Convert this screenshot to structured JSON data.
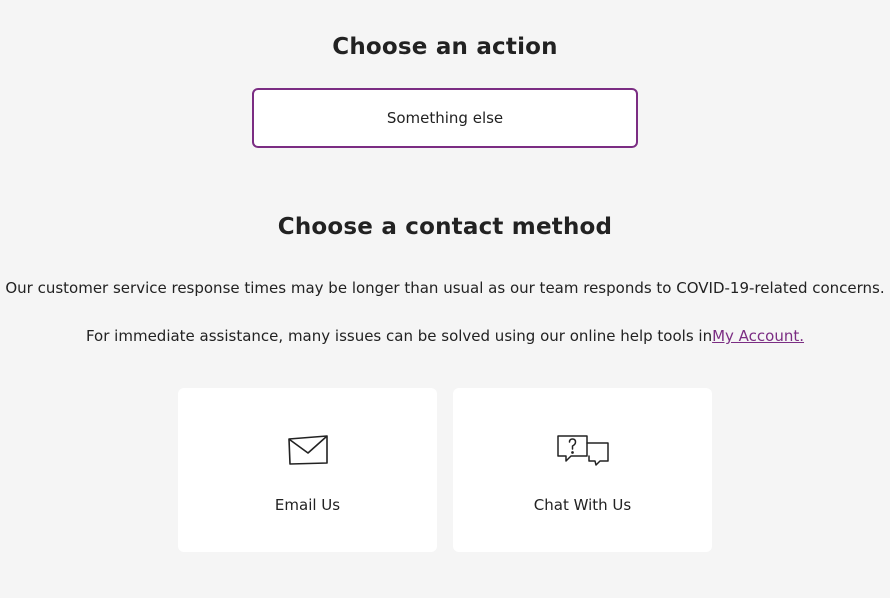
{
  "action_section": {
    "heading": "Choose an action",
    "selected_option": "Something else"
  },
  "contact_section": {
    "heading": "Choose a contact method",
    "notice_line1": "Our customer service response times may be longer than usual as our team responds to COVID-19-related concerns.",
    "notice_line2_prefix": "For immediate assistance, many issues can be solved using our online help tools in",
    "notice_line2_link": "My Account.",
    "methods": [
      {
        "label": "Email Us",
        "icon": "envelope-icon"
      },
      {
        "label": "Chat With Us",
        "icon": "chat-bubbles-icon"
      }
    ]
  },
  "colors": {
    "accent": "#7b2d83",
    "background": "#f5f5f5",
    "card": "#ffffff",
    "text": "#222222"
  }
}
